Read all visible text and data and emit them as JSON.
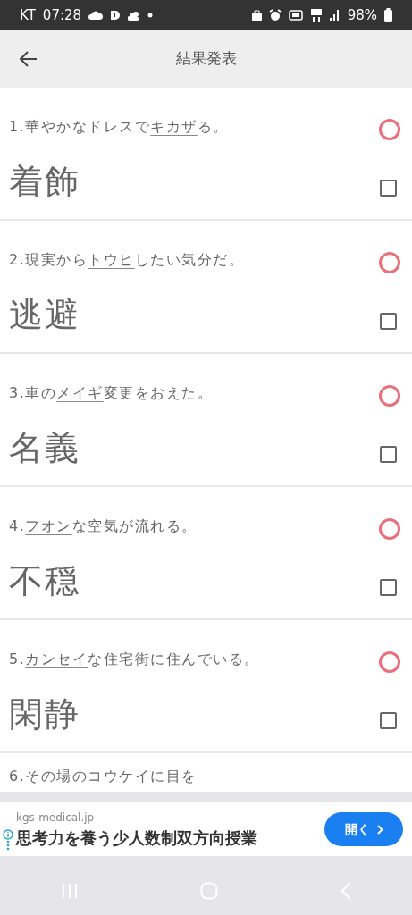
{
  "status_bar": {
    "carrier": "KT",
    "time": "07:28",
    "battery": "98%"
  },
  "app_bar": {
    "title": "結果発表"
  },
  "items": [
    {
      "question": [
        {
          "text": "1.華やかなドレスで",
          "underlined": false
        },
        {
          "text": "キカザ",
          "underlined": true
        },
        {
          "text": "る。",
          "underlined": false
        }
      ],
      "answer": "着飾",
      "correct": true,
      "checked": false
    },
    {
      "question": [
        {
          "text": "2.現実から",
          "underlined": false
        },
        {
          "text": "トウヒ",
          "underlined": true
        },
        {
          "text": "したい気分だ。",
          "underlined": false
        }
      ],
      "answer": "逃避",
      "correct": true,
      "checked": false
    },
    {
      "question": [
        {
          "text": "3.車の",
          "underlined": false
        },
        {
          "text": "メイギ",
          "underlined": true
        },
        {
          "text": "変更をおえた。",
          "underlined": false
        }
      ],
      "answer": "名義",
      "correct": true,
      "checked": false
    },
    {
      "question": [
        {
          "text": "4.",
          "underlined": false
        },
        {
          "text": "フオン",
          "underlined": true
        },
        {
          "text": "な空気が流れる。",
          "underlined": false
        }
      ],
      "answer": "不穏",
      "correct": true,
      "checked": false
    },
    {
      "question": [
        {
          "text": "5.",
          "underlined": false
        },
        {
          "text": "カンセイ",
          "underlined": true
        },
        {
          "text": "な住宅街に住んでいる。",
          "underlined": false
        }
      ],
      "answer": "閑静",
      "correct": true,
      "checked": false
    },
    {
      "question": [
        {
          "text": "6.その場のコウケイに目を",
          "underlined": false
        }
      ]
    }
  ],
  "ad": {
    "domain": "kgs-medical.jp",
    "headline": "思考力を養う少人数制双方向授業",
    "button": "開く"
  }
}
